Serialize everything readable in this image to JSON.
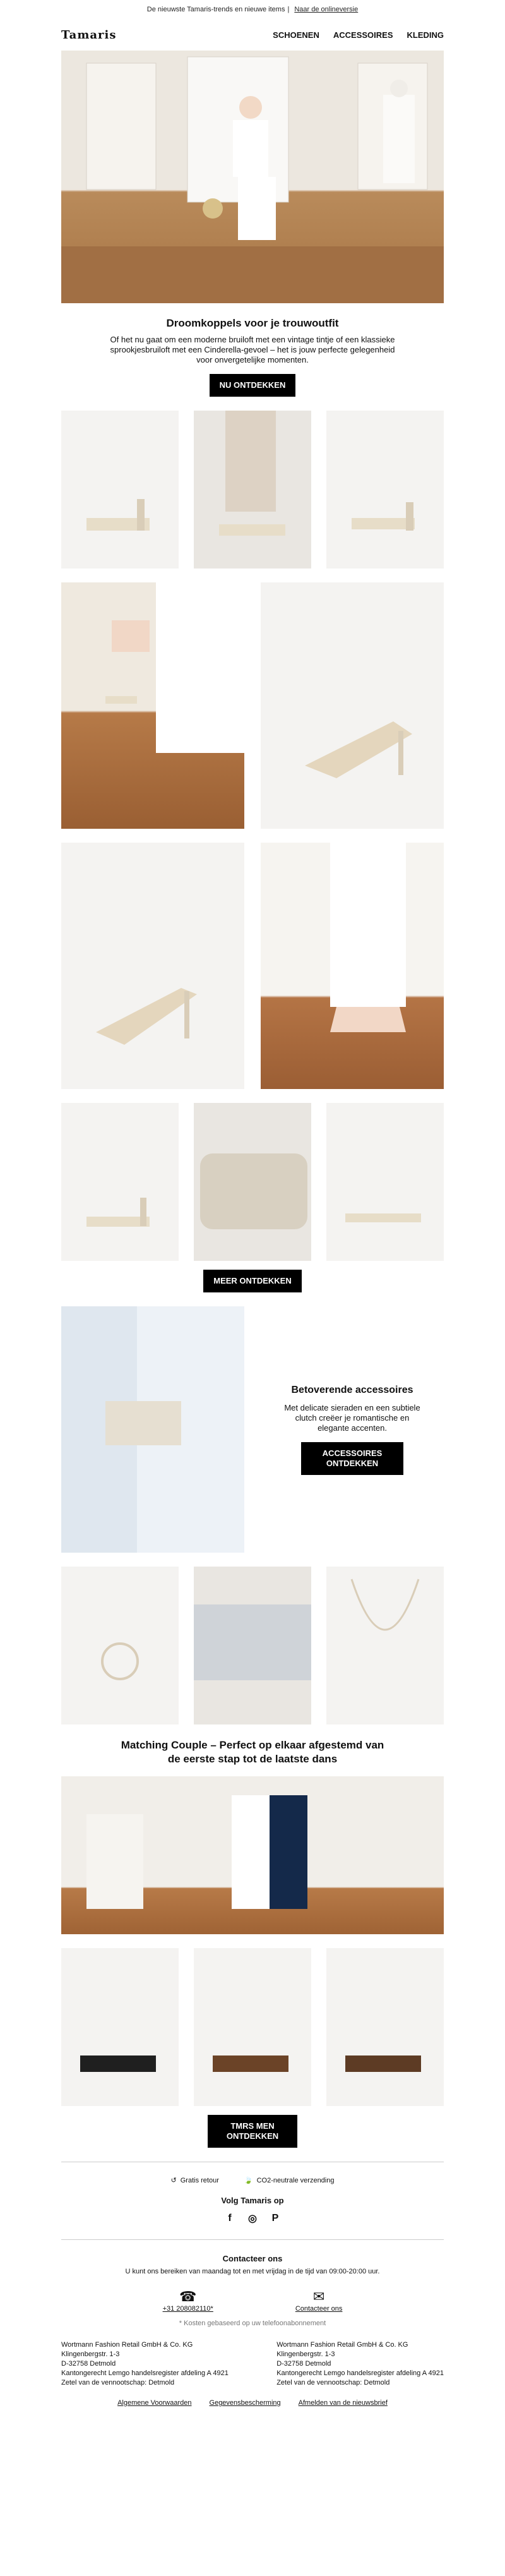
{
  "topbar": {
    "text": "De nieuwste Tamaris-trends en nieuwe items",
    "link": "Naar de onlineversie"
  },
  "brand": {
    "logo": "Tamaris"
  },
  "nav": [
    "SCHOENEN",
    "ACCESSOIRES",
    "KLEDING"
  ],
  "section1": {
    "title": "Droomkoppels voor je trouwoutfit",
    "text": "Of het nu gaat om een moderne bruiloft met een vintage tintje of een klassieke sprookjesbruiloft met een Cinderella-gevoel – het is jouw perfecte gelegenheid voor onvergetelijke momenten.",
    "cta": "NU ONTDEKKEN"
  },
  "section2": {
    "cta": "MEER ONTDEKKEN"
  },
  "accessories": {
    "title": "Betoverende accessoires",
    "text": "Met delicate sieraden en een subtiele clutch creëer je romantische en elegante accenten.",
    "cta": "ACCESSOIRES ONTDEKKEN"
  },
  "couple": {
    "title": "Matching Couple – Perfect op elkaar afgestemd van de eerste stap tot de laatste dans",
    "cta": "TMRS MEN ONTDEKKEN"
  },
  "footer": {
    "benefits": [
      "Gratis retour",
      "CO2-neutrale verzending"
    ],
    "follow": "Volg Tamaris op",
    "contact_title": "Contacteer ons",
    "contact_text": "U kunt ons bereiken van maandag tot en met vrijdag in de tijd van 09:00-20:00 uur.",
    "phone": "+31 208082110*",
    "email": "Contacteer ons",
    "note": "* Kosten gebaseerd op uw telefoonabonnement",
    "address_left": [
      "Wortmann Fashion Retail GmbH & Co. KG",
      "Klingenbergstr. 1-3",
      "D-32758 Detmold",
      "Kantongerecht Lemgo handelsregister afdeling A 4921",
      "Zetel van de vennootschap: Detmold"
    ],
    "address_right": [
      "Wortmann Fashion Retail GmbH & Co. KG",
      "Klingenbergstr. 1-3",
      "D-32758 Detmold",
      "Kantongerecht Lemgo handelsregister afdeling A 4921",
      "Zetel van de vennootschap: Detmold"
    ],
    "links": [
      "Algemene Voorwaarden",
      "Gegevensbescherming",
      "Afmelden van de nieuwsbrief"
    ]
  }
}
